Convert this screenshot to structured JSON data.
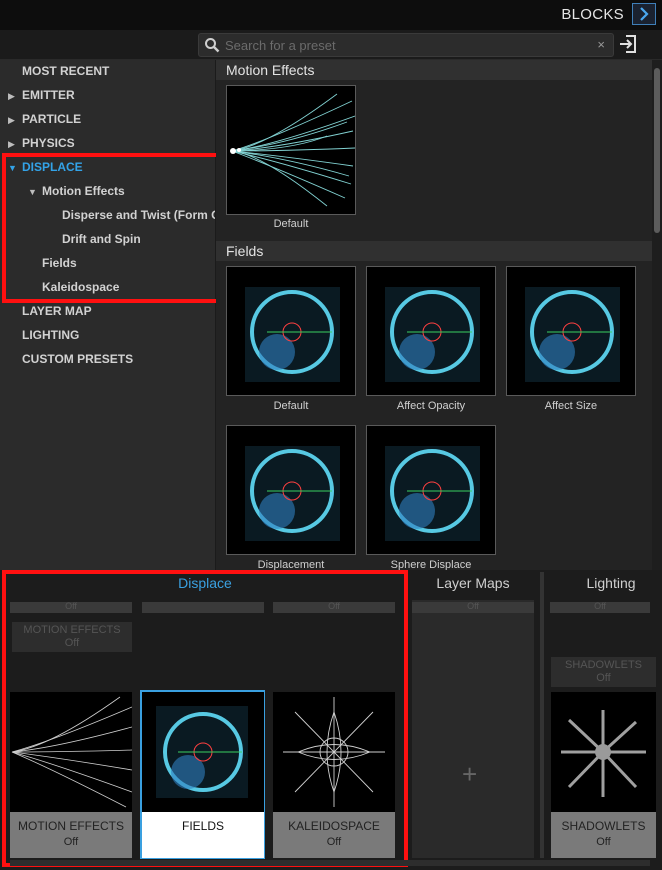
{
  "header": {
    "title": "BLOCKS"
  },
  "search": {
    "placeholder": "Search for a preset",
    "clear": "×"
  },
  "sidebar": {
    "items": [
      {
        "label": "MOST RECENT",
        "arrow": ""
      },
      {
        "label": "EMITTER",
        "arrow": "▶"
      },
      {
        "label": "PARTICLE",
        "arrow": "▶"
      },
      {
        "label": "PHYSICS",
        "arrow": "▶"
      },
      {
        "label": "DISPLACE",
        "arrow": "▼"
      },
      {
        "label": "Motion Effects",
        "arrow": "▼"
      },
      {
        "label": "Disperse and Twist (Form On",
        "arrow": ""
      },
      {
        "label": "Drift and Spin",
        "arrow": ""
      },
      {
        "label": "Fields",
        "arrow": ""
      },
      {
        "label": "Kaleidospace",
        "arrow": ""
      },
      {
        "label": "LAYER MAP",
        "arrow": ""
      },
      {
        "label": "LIGHTING",
        "arrow": ""
      },
      {
        "label": "CUSTOM PRESETS",
        "arrow": ""
      }
    ]
  },
  "content": {
    "sections": [
      {
        "title": "Motion Effects",
        "presets": [
          "Default"
        ]
      },
      {
        "title": "Fields",
        "presets": [
          "Default",
          "Affect Opacity",
          "Affect Size",
          "Displacement",
          "Sphere Displace"
        ]
      }
    ]
  },
  "bottom": {
    "tabs": [
      {
        "label": "Displace",
        "color": "#3aa0e0"
      },
      {
        "label": "Layer Maps",
        "color": "#cfcfcf"
      },
      {
        "label": "Lighting",
        "color": "#cfcfcf"
      }
    ],
    "top_slots": [
      {
        "label": "Off"
      },
      {
        "label": ""
      },
      {
        "label": "Off"
      },
      {
        "label": "Off"
      },
      {
        "label": "Off"
      }
    ],
    "ghosts": [
      {
        "name": "MOTION EFFECTS",
        "state": "Off"
      },
      {
        "name": "SHADOWLETS",
        "state": "Off"
      }
    ],
    "cards": [
      {
        "name": "MOTION EFFECTS",
        "state": "Off"
      },
      {
        "name": "FIELDS",
        "state": ""
      },
      {
        "name": "KALEIDOSPACE",
        "state": "Off"
      },
      {
        "name": "SHADOWLETS",
        "state": "Off"
      }
    ],
    "add": "+"
  },
  "colors": {
    "accent": "#3aa0e0",
    "highlight": "#ff1010"
  }
}
